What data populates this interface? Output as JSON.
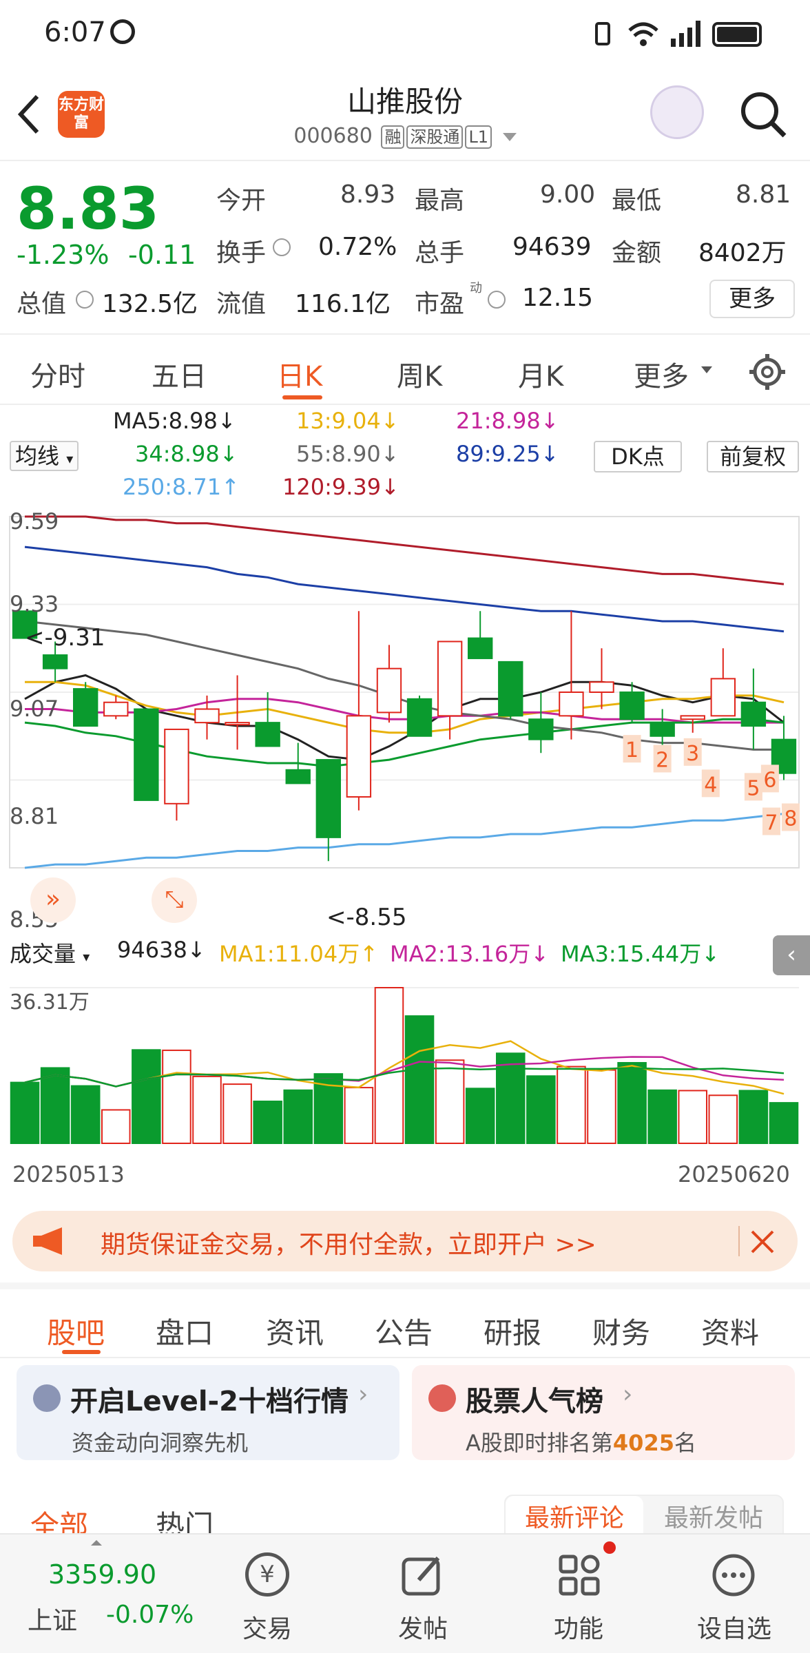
{
  "status_bar": {
    "time": "6:07"
  },
  "header": {
    "title": "山推股份",
    "code": "000680",
    "tags": [
      "融",
      "深股通",
      "L1"
    ],
    "logo_text": "东方财富"
  },
  "quote": {
    "price": "8.83",
    "change_pct": "-1.23%",
    "change": "-0.11",
    "open_label": "今开",
    "open": "8.93",
    "high_label": "最高",
    "high": "9.00",
    "low_label": "最低",
    "low": "8.81",
    "turnover_label": "换手",
    "turnover": "0.72%",
    "volume_label": "总手",
    "volume": "94639",
    "amount_label": "金额",
    "amount": "8402万",
    "mktcap_label": "总值",
    "mktcap": "132.5亿",
    "float_label": "流值",
    "float": "116.1亿",
    "pe_label": "市盈",
    "pe_sup": "动",
    "pe": "12.15",
    "more_label": "更多"
  },
  "chart_tabs": [
    "分时",
    "五日",
    "日K",
    "周K",
    "月K",
    "更多"
  ],
  "ma_legend": {
    "selector": "均线",
    "ma5": "MA5:8.98↓",
    "ma13": "13:9.04↓",
    "ma21": "21:8.98↓",
    "ma34": "34:8.98↓",
    "ma55": "55:8.90↓",
    "ma89": "89:9.25↓",
    "ma250": "250:8.71↑",
    "ma120": "120:9.39↓",
    "dk_button": "DK点",
    "adj_button": "前复权"
  },
  "price_axis": [
    "9.59",
    "9.33",
    "9.07",
    "8.81",
    "8.55"
  ],
  "kline_markers": {
    "high": "<-9.31",
    "low": "<-8.55"
  },
  "dk_points": [
    "1",
    "2",
    "3",
    "4",
    "5",
    "6",
    "7",
    "8"
  ],
  "volume_legend": {
    "selector": "成交量",
    "vol": "94638↓",
    "ma1": "MA1:11.04万↑",
    "ma2": "MA2:13.16万↓",
    "ma3": "MA3:15.44万↓",
    "max": "36.31万"
  },
  "date_range": {
    "start": "20250513",
    "end": "20250620"
  },
  "colors": {
    "up": "#e0251b",
    "down": "#0a9b2e",
    "accent": "#ee5a24"
  },
  "chart_data": {
    "type": "candlestick",
    "candles": [
      {
        "o": 9.31,
        "h": 9.31,
        "l": 9.23,
        "c": 9.23
      },
      {
        "o": 9.18,
        "h": 9.22,
        "l": 9.1,
        "c": 9.14
      },
      {
        "o": 9.08,
        "h": 9.1,
        "l": 8.97,
        "c": 8.97
      },
      {
        "o": 9.0,
        "h": 9.06,
        "l": 8.99,
        "c": 9.04
      },
      {
        "o": 9.02,
        "h": 9.02,
        "l": 8.75,
        "c": 8.75
      },
      {
        "o": 8.74,
        "h": 8.96,
        "l": 8.69,
        "c": 8.96
      },
      {
        "o": 8.98,
        "h": 9.06,
        "l": 8.93,
        "c": 9.02
      },
      {
        "o": 8.98,
        "h": 9.12,
        "l": 8.9,
        "c": 8.98
      },
      {
        "o": 8.98,
        "h": 9.07,
        "l": 8.91,
        "c": 8.91
      },
      {
        "o": 8.84,
        "h": 8.92,
        "l": 8.8,
        "c": 8.8
      },
      {
        "o": 8.87,
        "h": 8.87,
        "l": 8.57,
        "c": 8.64
      },
      {
        "o": 8.76,
        "h": 9.31,
        "l": 8.72,
        "c": 9.0
      },
      {
        "o": 9.01,
        "h": 9.21,
        "l": 8.98,
        "c": 9.14
      },
      {
        "o": 9.05,
        "h": 9.06,
        "l": 8.94,
        "c": 8.94
      },
      {
        "o": 9.0,
        "h": 9.21,
        "l": 8.93,
        "c": 9.22
      },
      {
        "o": 9.23,
        "h": 9.31,
        "l": 9.17,
        "c": 9.17
      },
      {
        "o": 9.16,
        "h": 9.16,
        "l": 8.99,
        "c": 9.0
      },
      {
        "o": 8.99,
        "h": 9.07,
        "l": 8.89,
        "c": 8.93
      },
      {
        "o": 9.0,
        "h": 9.31,
        "l": 8.93,
        "c": 9.07
      },
      {
        "o": 9.07,
        "h": 9.2,
        "l": 9.02,
        "c": 9.1
      },
      {
        "o": 9.07,
        "h": 9.1,
        "l": 8.98,
        "c": 8.99
      },
      {
        "o": 8.98,
        "h": 9.02,
        "l": 8.91,
        "c": 8.94
      },
      {
        "o": 8.99,
        "h": 9.0,
        "l": 8.95,
        "c": 9.0
      },
      {
        "o": 9.0,
        "h": 9.2,
        "l": 9.0,
        "c": 9.11
      },
      {
        "o": 9.04,
        "h": 9.14,
        "l": 8.9,
        "c": 8.97
      },
      {
        "o": 8.93,
        "h": 9.0,
        "l": 8.81,
        "c": 8.83
      }
    ],
    "volumes": [
      14.2,
      17.6,
      13.4,
      7.8,
      21.8,
      21.7,
      15.6,
      13.8,
      9.8,
      12.4,
      16.2,
      13.0,
      36.31,
      29.7,
      19.4,
      12.8,
      21.0,
      15.7,
      17.9,
      17.1,
      18.8,
      12.4,
      12.3,
      11.2,
      12.3,
      9.46
    ],
    "ylim": [
      8.55,
      9.59
    ],
    "vol_max": 36.31,
    "ma_lines": [
      {
        "name": "MA5",
        "values": [
          9.05,
          9.1,
          9.12,
          9.08,
          9.02,
          9.0,
          8.98,
          8.97,
          8.97,
          8.93,
          8.88,
          8.87,
          8.91,
          8.96,
          9.02,
          9.05,
          9.05,
          9.07,
          9.1,
          9.1,
          9.09,
          9.06,
          9.04,
          9.06,
          9.05,
          8.98
        ]
      },
      {
        "name": "13",
        "values": [
          9.1,
          9.1,
          9.09,
          9.06,
          9.03,
          9.01,
          9.0,
          9.01,
          9.02,
          9.0,
          8.98,
          8.96,
          8.95,
          8.95,
          8.96,
          8.99,
          9.0,
          9.01,
          9.02,
          9.03,
          9.04,
          9.05,
          9.05,
          9.06,
          9.06,
          9.04
        ]
      },
      {
        "name": "21",
        "values": [
          9.02,
          9.02,
          9.01,
          9.01,
          9.01,
          9.02,
          9.04,
          9.05,
          9.05,
          9.04,
          9.02,
          9.0,
          8.99,
          8.99,
          9.0,
          9.0,
          9.01,
          9.01,
          9.0,
          8.99,
          8.99,
          8.99,
          8.98,
          8.98,
          8.98,
          8.98
        ]
      },
      {
        "name": "34",
        "values": [
          8.98,
          8.97,
          8.95,
          8.94,
          8.92,
          8.9,
          8.88,
          8.87,
          8.86,
          8.86,
          8.85,
          8.86,
          8.87,
          8.89,
          8.91,
          8.93,
          8.94,
          8.95,
          8.96,
          8.97,
          8.98,
          8.98,
          8.98,
          8.99,
          8.99,
          8.98
        ]
      },
      {
        "name": "55",
        "values": [
          9.28,
          9.27,
          9.26,
          9.25,
          9.24,
          9.22,
          9.2,
          9.18,
          9.16,
          9.14,
          9.11,
          9.09,
          9.06,
          9.03,
          9.01,
          9.0,
          8.99,
          8.97,
          8.96,
          8.95,
          8.93,
          8.92,
          8.92,
          8.91,
          8.9,
          8.9
        ]
      },
      {
        "name": "89",
        "values": [
          9.5,
          9.49,
          9.48,
          9.47,
          9.46,
          9.45,
          9.44,
          9.42,
          9.41,
          9.39,
          9.38,
          9.37,
          9.36,
          9.35,
          9.34,
          9.33,
          9.32,
          9.31,
          9.31,
          9.3,
          9.29,
          9.28,
          9.28,
          9.27,
          9.26,
          9.25
        ]
      },
      {
        "name": "120",
        "values": [
          9.59,
          9.59,
          9.59,
          9.58,
          9.58,
          9.57,
          9.57,
          9.56,
          9.55,
          9.54,
          9.53,
          9.52,
          9.51,
          9.5,
          9.49,
          9.48,
          9.47,
          9.46,
          9.45,
          9.44,
          9.43,
          9.42,
          9.42,
          9.41,
          9.4,
          9.39
        ]
      },
      {
        "name": "250",
        "values": [
          8.55,
          8.56,
          8.56,
          8.57,
          8.58,
          8.58,
          8.59,
          8.6,
          8.6,
          8.61,
          8.61,
          8.62,
          8.62,
          8.63,
          8.64,
          8.64,
          8.65,
          8.65,
          8.66,
          8.67,
          8.67,
          8.68,
          8.69,
          8.69,
          8.7,
          8.71
        ]
      }
    ]
  },
  "banner": {
    "text": "期货保证金交易，不用付全款，立即开户 >>"
  },
  "section_tabs": [
    "股吧",
    "盘口",
    "资讯",
    "公告",
    "研报",
    "财务",
    "资料"
  ],
  "cards": [
    {
      "title": "开启Level-2十档行情",
      "sub": "资金动向洞察先机"
    },
    {
      "title": "股票人气榜",
      "sub_prefix": "A股即时排名第",
      "sub_num": "4025",
      "sub_suffix": "名"
    }
  ],
  "feed_tabs": [
    "全部",
    "热门"
  ],
  "sort_tabs": [
    "最新评论",
    "最新发帖"
  ],
  "bottom_bar": {
    "index_value": "3359.90",
    "index_name": "上证",
    "index_change": "-0.07%",
    "items": [
      "交易",
      "发帖",
      "功能",
      "设自选"
    ]
  }
}
